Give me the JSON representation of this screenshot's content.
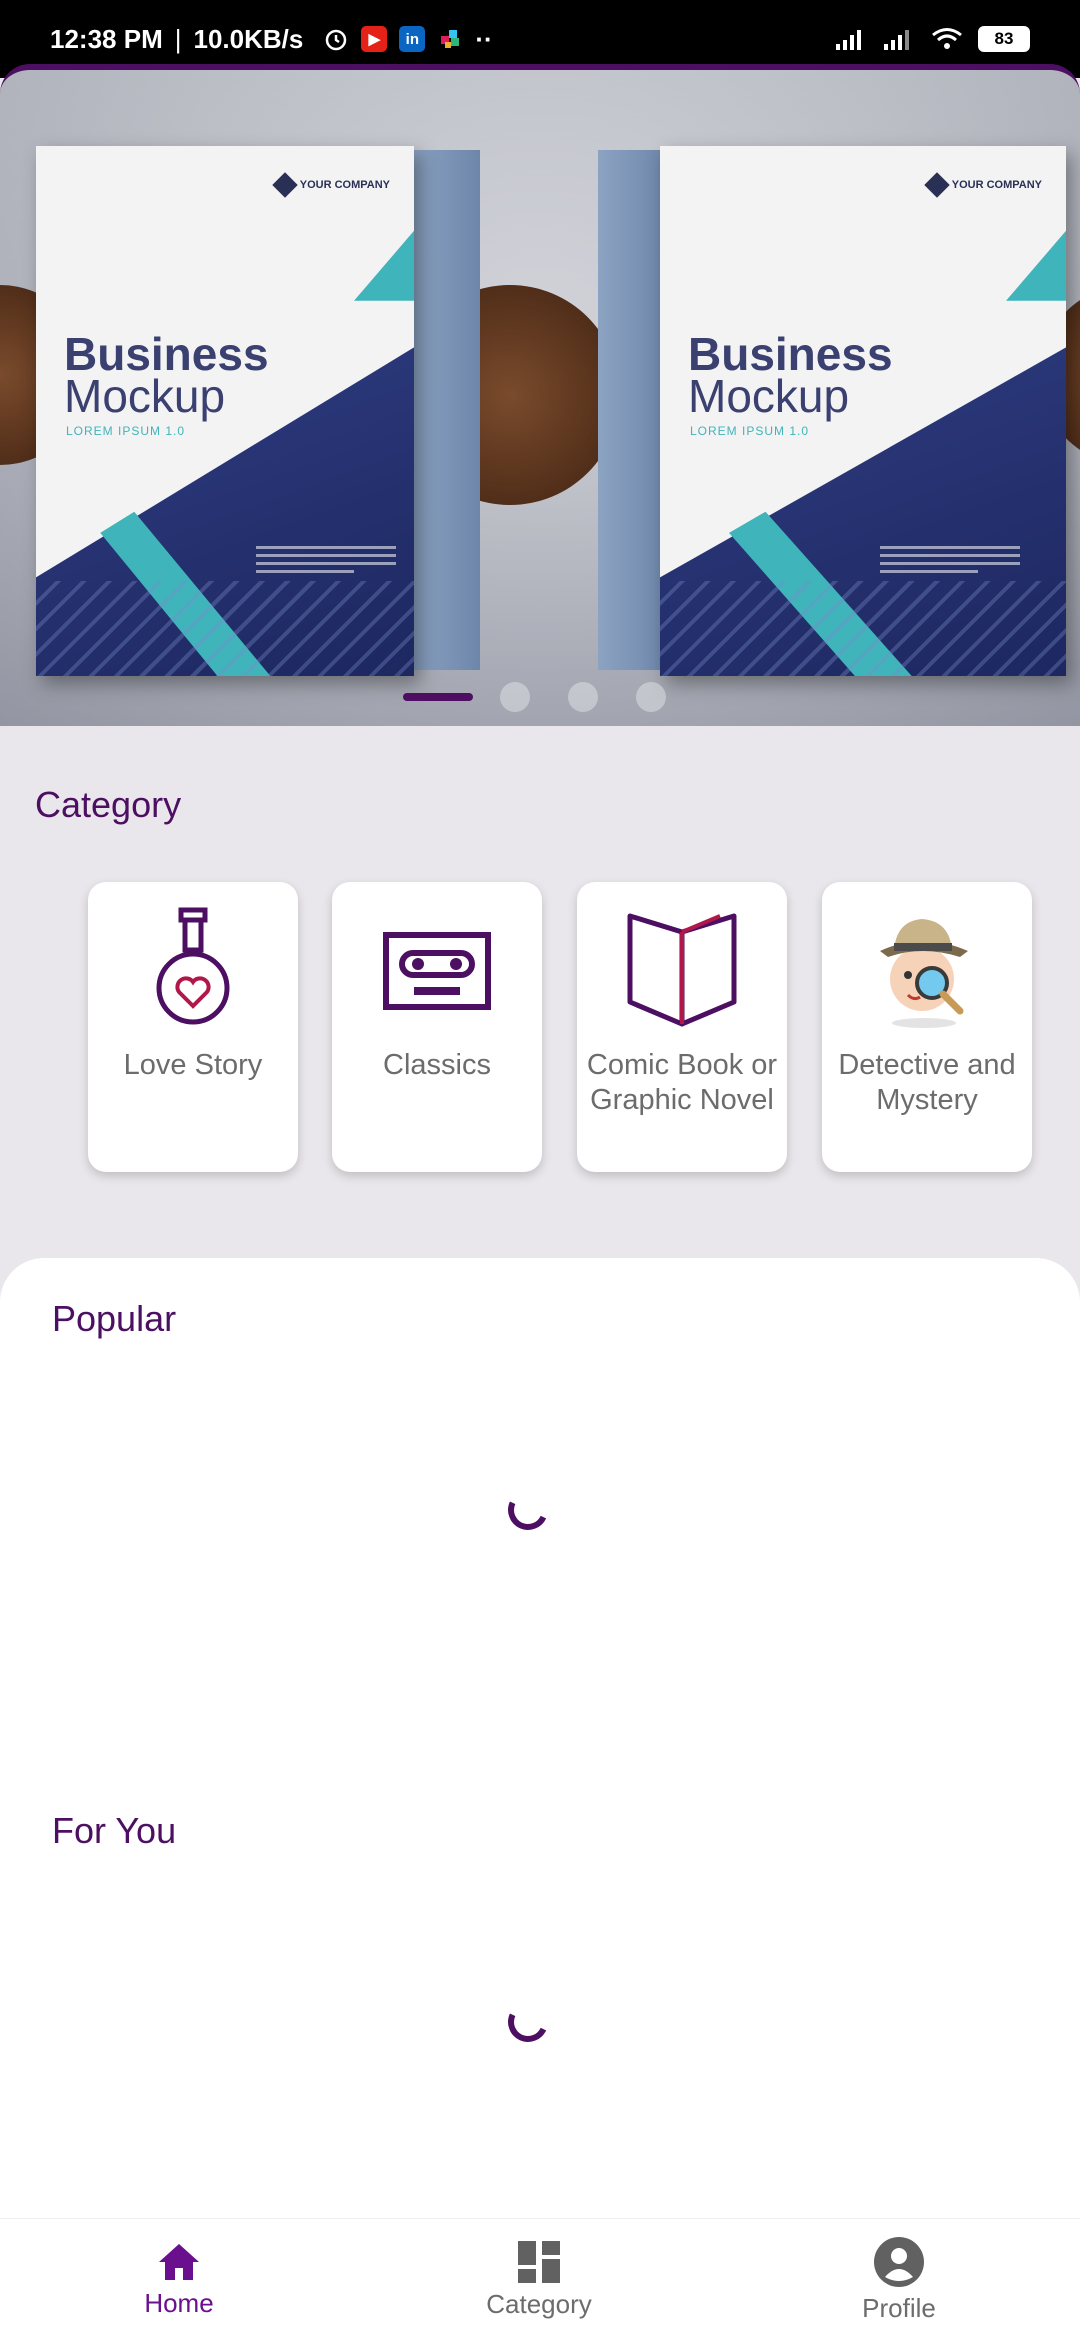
{
  "status_bar": {
    "time": "12:38 PM",
    "net_speed": "10.0KB/s",
    "battery": "83",
    "more": "··"
  },
  "banner": {
    "books": [
      {
        "company": "YOUR COMPANY",
        "title1": "Business",
        "title2": "Mockup",
        "subtitle": "LOREM IPSUM 1.0"
      },
      {
        "company": "YOUR COMPANY",
        "title1": "Business",
        "title2": "Mockup",
        "subtitle": "LOREM IPSUM 1.0"
      }
    ],
    "pager": {
      "count": 4,
      "active_index": 0
    }
  },
  "category": {
    "title": "Category",
    "items": [
      {
        "label": "Love Story",
        "icon": "love-potion-icon"
      },
      {
        "label": "Classics",
        "icon": "cassette-tape-icon"
      },
      {
        "label": "Comic Book or Graphic Novel",
        "icon": "open-book-icon"
      },
      {
        "label": "Detective and Mystery",
        "icon": "detective-icon"
      }
    ]
  },
  "popular": {
    "title": "Popular"
  },
  "for_you": {
    "title": "For You"
  },
  "bottom_nav": {
    "items": [
      {
        "label": "Home",
        "icon": "home-icon",
        "active": true
      },
      {
        "label": "Category",
        "icon": "dashboard-icon",
        "active": false
      },
      {
        "label": "Profile",
        "icon": "profile-icon",
        "active": false
      }
    ]
  },
  "colors": {
    "primary": "#4c0f62",
    "accent": "#6a0f8e",
    "background": "#e9e7eb"
  }
}
